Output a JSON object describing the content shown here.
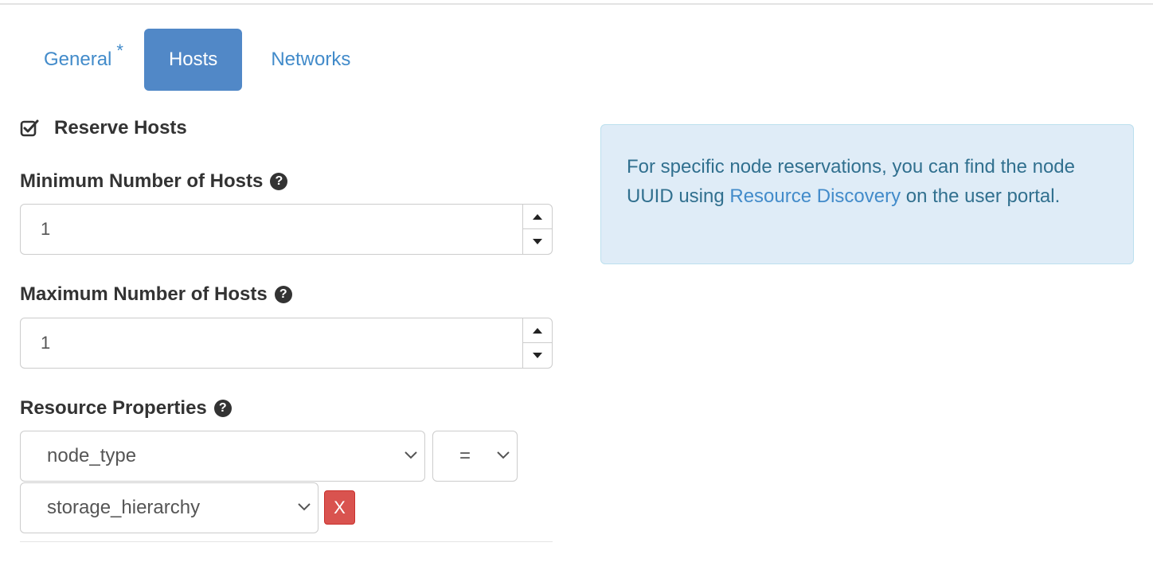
{
  "tabs": {
    "general": {
      "label": "General",
      "required_marker": "*"
    },
    "hosts": {
      "label": "Hosts"
    },
    "networks": {
      "label": "Networks"
    }
  },
  "reserve_hosts": {
    "label": "Reserve Hosts",
    "checked": true
  },
  "min_hosts": {
    "label": "Minimum Number of Hosts",
    "help_icon": "question-circle-icon",
    "value": "1"
  },
  "max_hosts": {
    "label": "Maximum Number of Hosts",
    "help_icon": "question-circle-icon",
    "value": "1"
  },
  "resource_properties": {
    "label": "Resource Properties",
    "help_icon": "question-circle-icon",
    "property_select": {
      "value": "node_type"
    },
    "operator_select": {
      "value": "="
    },
    "value_select": {
      "value": "storage_hierarchy"
    },
    "remove_button_label": "X"
  },
  "info": {
    "text_before": "For specific node reservations, you can find the node UUID using ",
    "link_text": "Resource Discovery",
    "text_after": " on the user portal."
  },
  "colors": {
    "primary": "#5188c7",
    "link": "#428bca",
    "danger": "#d9534f",
    "info_bg": "#dfecf7",
    "info_text": "#31708f"
  }
}
